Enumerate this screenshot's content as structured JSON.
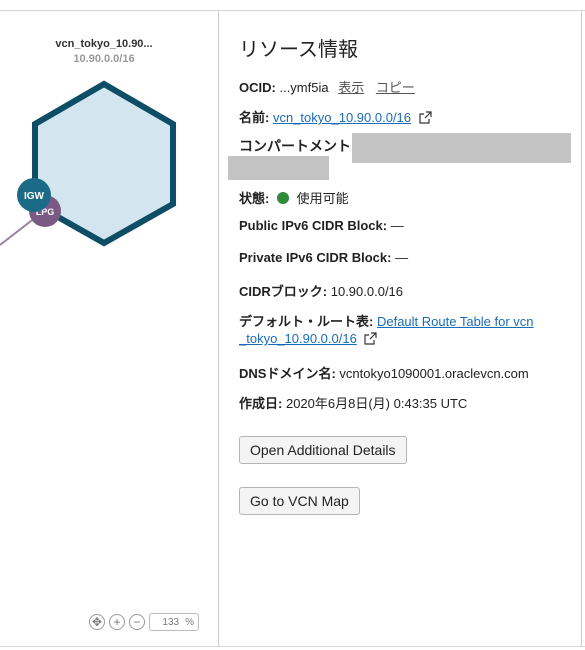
{
  "map": {
    "vcn_name": "vcn_tokyo_10.90...",
    "vcn_cidr": "10.90.0.0/16",
    "igw_label": "IGW",
    "lpg_label": "LPG",
    "zoom_value": "133",
    "zoom_unit": "%",
    "colors": {
      "hex_fill": "#d3e6f0",
      "hex_stroke": "#0e4d66",
      "igw": "#1c6b86",
      "lpg": "#7a5a85"
    }
  },
  "details": {
    "title": "リソース情報",
    "ocid_label": "OCID:",
    "ocid_value": "...ymf5ia",
    "ocid_show": "表示",
    "ocid_copy": "コピー",
    "name_label": "名前:",
    "name_value": "vcn_tokyo_10.90.0.0/16",
    "compartment_label": "コンパートメント",
    "state_label": "状態:",
    "state_value": "使用可能",
    "ipv6_public_label": "Public IPv6 CIDR Block:",
    "ipv6_public_value": "—",
    "ipv6_private_label": "Private IPv6 CIDR Block:",
    "ipv6_private_value": "—",
    "cidr_label": "CIDRブロック:",
    "cidr_value": "10.90.0.0/16",
    "route_label": "デフォルト・ルート表:",
    "route_value_line1": "Default Route Table for vcn",
    "route_value_line2": "_tokyo_10.90.0.0/16",
    "dns_label": "DNSドメイン名:",
    "dns_value": "vcntokyo1090001.oraclevcn.com",
    "created_label": "作成日:",
    "created_value": "2020年6月8日(月) 0:43:35 UTC"
  },
  "buttons": {
    "additional": "Open Additional Details",
    "vcn_map": "Go to VCN Map"
  }
}
